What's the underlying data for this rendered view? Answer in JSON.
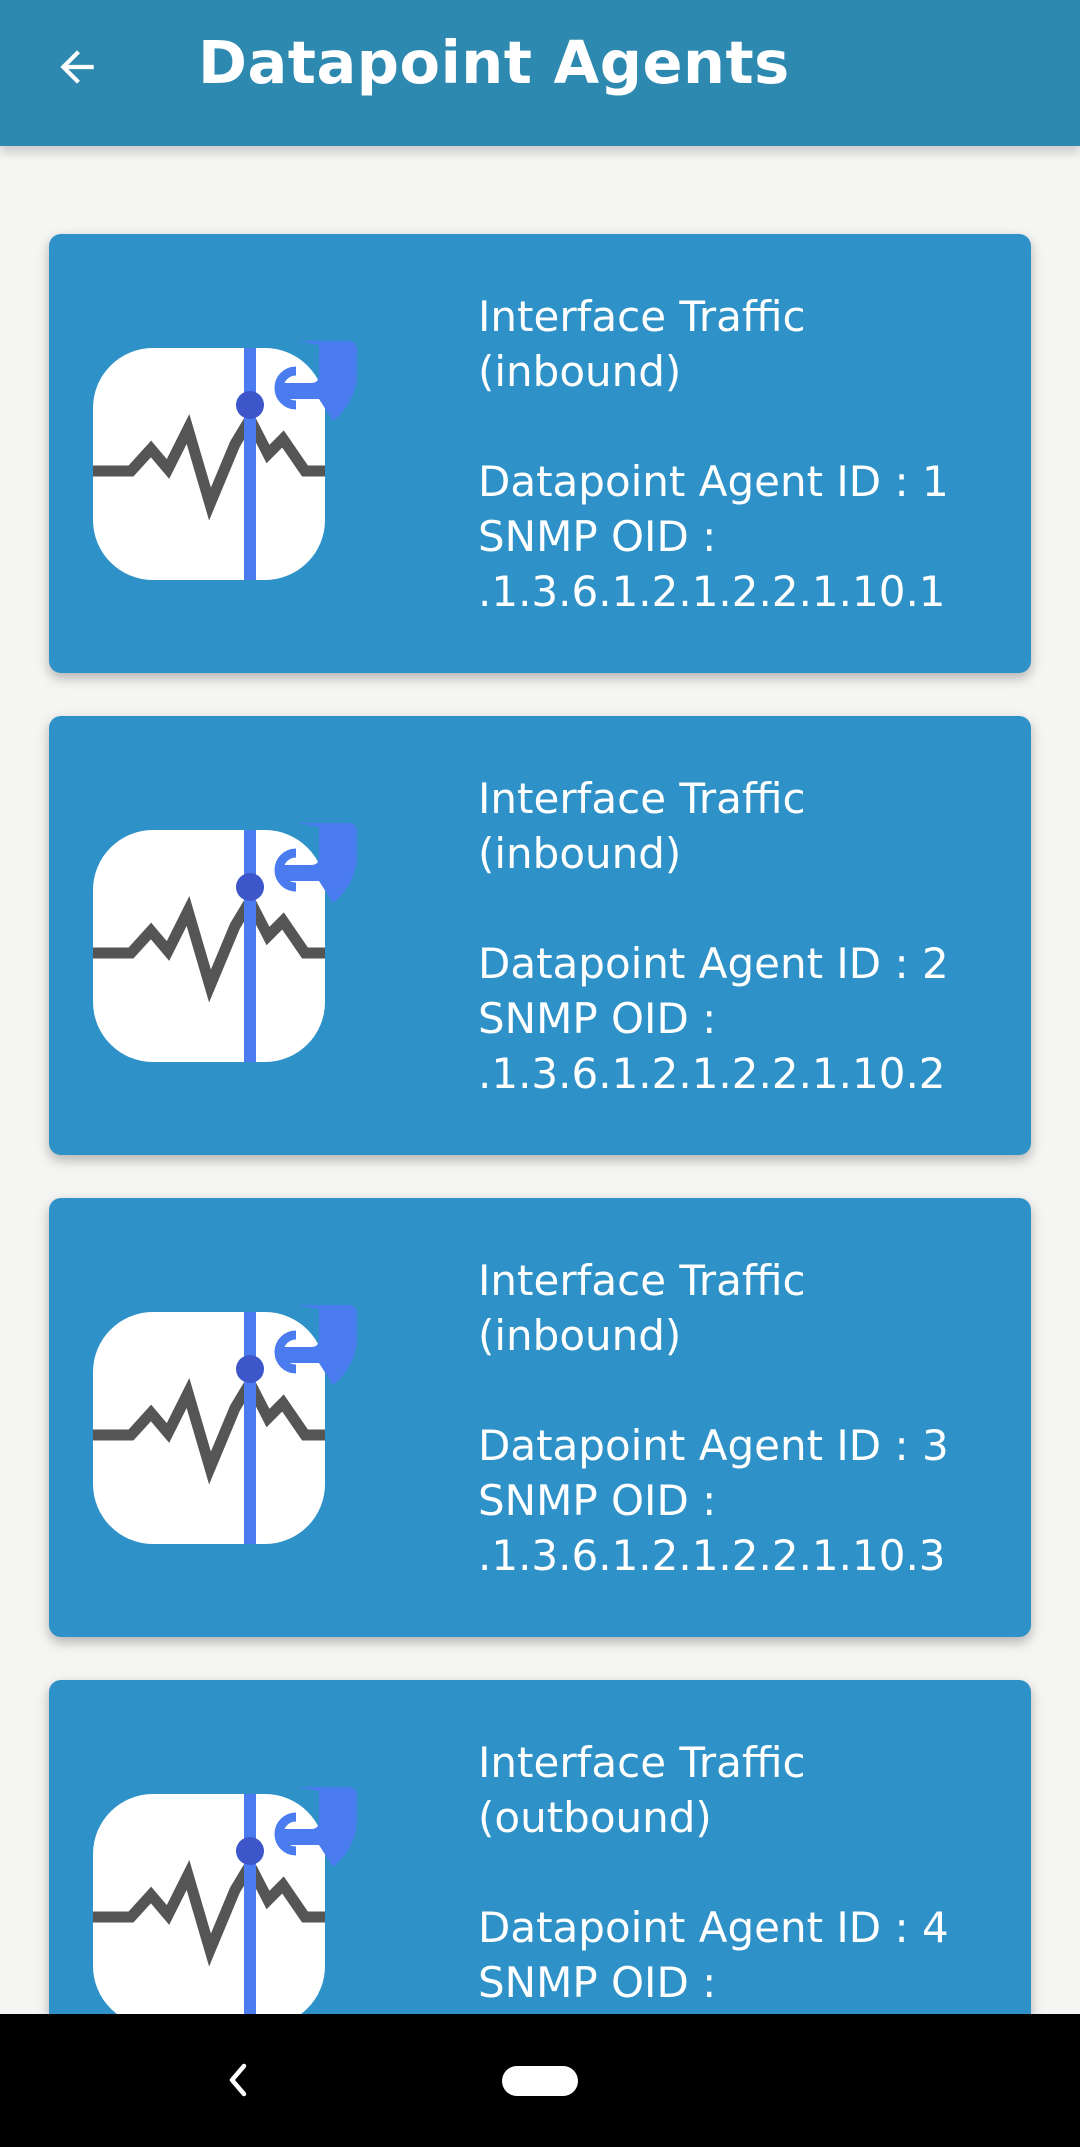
{
  "header": {
    "title": "Datapoint Agents",
    "back_icon": "arrow-left-icon"
  },
  "colors": {
    "appbar": "#2e89b0",
    "card": "#2e92c8",
    "background": "#f5f5f3",
    "icon_accent": "#4a7cf0"
  },
  "agents": [
    {
      "icon": "interface-traffic-icon",
      "name_line1": "Interface Traffic",
      "name_line2": "(inbound)",
      "id_text": "Datapoint Agent ID : 1",
      "oid_label": "SNMP OID :",
      "oid_value": ".1.3.6.1.2.1.2.2.1.10.1"
    },
    {
      "icon": "interface-traffic-icon",
      "name_line1": "Interface Traffic",
      "name_line2": "(inbound)",
      "id_text": "Datapoint Agent ID : 2",
      "oid_label": "SNMP OID :",
      "oid_value": ".1.3.6.1.2.1.2.2.1.10.2"
    },
    {
      "icon": "interface-traffic-icon",
      "name_line1": "Interface Traffic",
      "name_line2": "(inbound)",
      "id_text": "Datapoint Agent ID : 3",
      "oid_label": "SNMP OID :",
      "oid_value": ".1.3.6.1.2.1.2.2.1.10.3"
    },
    {
      "icon": "interface-traffic-icon",
      "name_line1": "Interface Traffic",
      "name_line2": "(outbound)",
      "id_text": "Datapoint Agent ID : 4",
      "oid_label": "SNMP OID :"
    }
  ],
  "navbar": {
    "back_icon": "nav-back-icon",
    "home_icon": "nav-home-pill-icon"
  }
}
